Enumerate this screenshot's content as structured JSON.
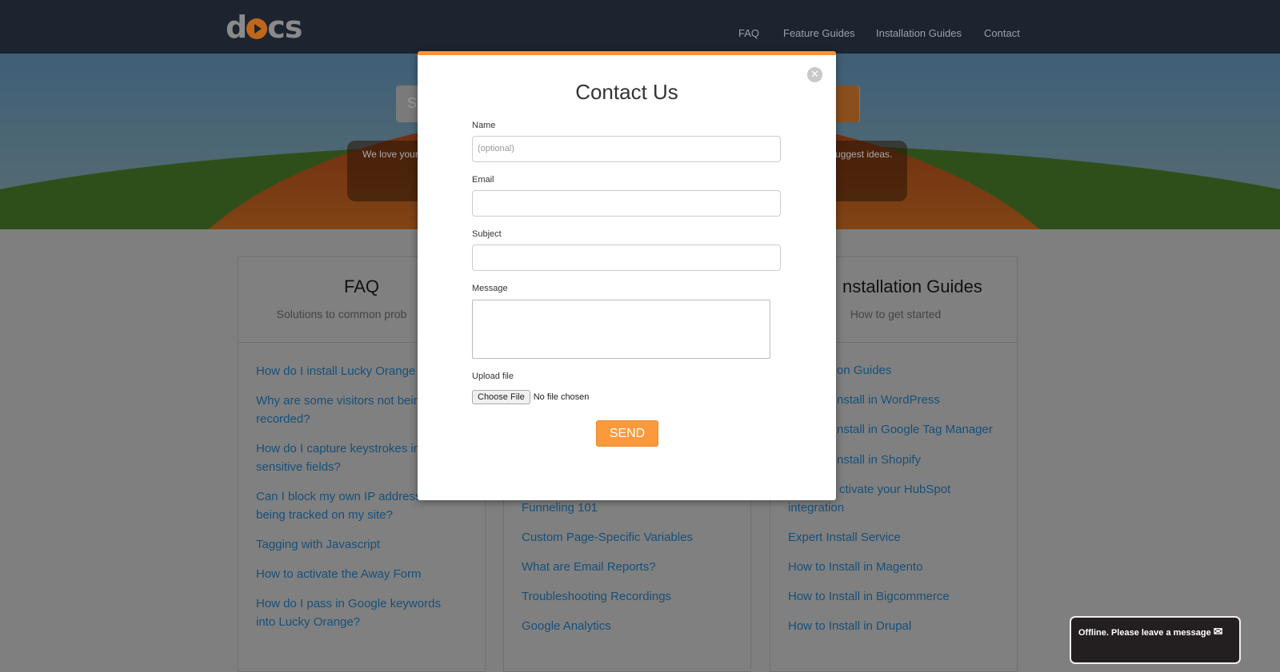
{
  "header": {
    "logo": "docs",
    "nav": [
      "FAQ",
      "Feature Guides",
      "Installation Guides",
      "Contact"
    ]
  },
  "hero": {
    "search_placeholder_fragment": "Se",
    "text_left": "We love your",
    "text_right": "uggest ideas."
  },
  "columns": [
    {
      "title": "FAQ",
      "subtitle": "Solutions to common prob",
      "items": [
        "How do I install Lucky Orange",
        "Why are some visitors not bein recorded?",
        "How do I capture keystrokes in sensitive fields?",
        "Can I block my own IP address being tracked on my site?",
        "Tagging with Javascript",
        "How to activate the Away Form",
        "How do I pass in Google keywords into Lucky Orange?"
      ]
    },
    {
      "items": [
        "Funneling 101",
        "Custom Page-Specific Variables",
        "What are Email Reports?",
        "Troubleshooting Recordings",
        "Google Analytics"
      ]
    },
    {
      "title": "nstallation Guides",
      "subtitle": "How to get started",
      "fragments": [
        "on Guides",
        "nstall in WordPress",
        "nstall in Google Tag Manager",
        "nstall in Shopify",
        "ctivate your HubSpot"
      ],
      "items": [
        "integration",
        "Expert Install Service",
        "How to Install in Magento",
        "How to Install in Bigcommerce",
        "How to Install in Drupal"
      ]
    }
  ],
  "modal": {
    "title": "Contact Us",
    "name_label": "Name",
    "name_placeholder": "(optional)",
    "email_label": "Email",
    "subject_label": "Subject",
    "message_label": "Message",
    "upload_label": "Upload file",
    "choose_file": "Choose File",
    "no_file": "No file chosen",
    "send": "SEND"
  },
  "chat": {
    "text": "Offline. Please leave a message"
  },
  "colors": {
    "accent": "#f7923a",
    "link": "#16507a",
    "header": "#1c2430"
  }
}
